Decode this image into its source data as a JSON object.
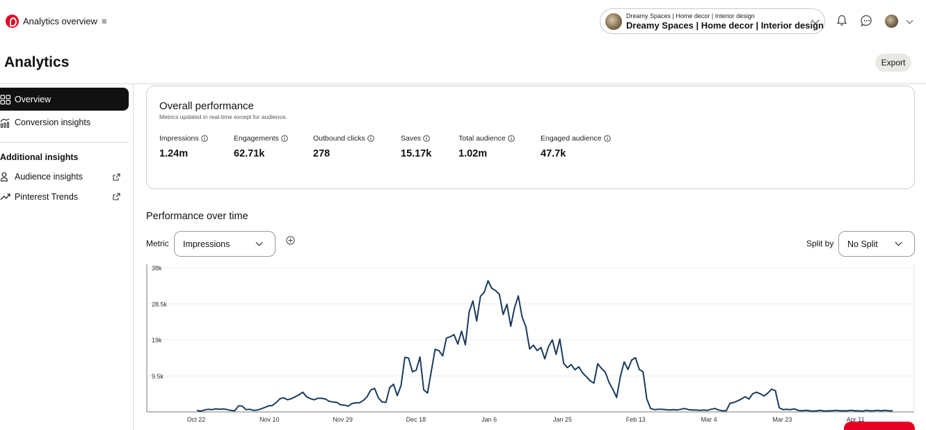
{
  "header": {
    "app_title": "Analytics overview",
    "account": {
      "small_line": "Dreamy Spaces | Home decor | Interior design",
      "name": "Dreamy Spaces | Home decor | Interior design"
    }
  },
  "page": {
    "title": "Analytics",
    "export_label": "Export"
  },
  "sidebar": {
    "items": [
      {
        "label": "Overview"
      },
      {
        "label": "Conversion insights"
      }
    ],
    "section_heading": "Additional insights",
    "extra_items": [
      {
        "label": "Audience insights"
      },
      {
        "label": "Pinterest Trends"
      }
    ]
  },
  "overall": {
    "title": "Overall performance",
    "subtitle": "Metrics updated in real-time except for audience.",
    "metrics": [
      {
        "label": "Impressions",
        "value": "1.24m"
      },
      {
        "label": "Engagements",
        "value": "62.71k"
      },
      {
        "label": "Outbound clicks",
        "value": "278"
      },
      {
        "label": "Saves",
        "value": "15.17k"
      },
      {
        "label": "Total audience",
        "value": "1.02m"
      },
      {
        "label": "Engaged audience",
        "value": "47.7k"
      }
    ]
  },
  "performance": {
    "title": "Performance over time",
    "metric_label": "Metric",
    "metric_value": "Impressions",
    "split_label": "Split by",
    "split_value": "No Split"
  },
  "chart_data": {
    "type": "line",
    "ylim": [
      0,
      38000
    ],
    "y_ticks": [
      "38k",
      "28.5k",
      "19k",
      "9.5k"
    ],
    "x_tick_labels": [
      "Oct 22",
      "Nov 10",
      "Nov 29",
      "Dec 18",
      "Jan 6",
      "Jan 25",
      "Feb 13",
      "Mar 4",
      "Mar 23",
      "Apr 11"
    ],
    "series": [
      {
        "color": "#1a3a5c",
        "values": [
          400,
          200,
          500,
          700,
          600,
          800,
          700,
          800,
          600,
          400,
          300,
          1600,
          1500,
          600,
          700,
          400,
          500,
          800,
          1200,
          1600,
          1700,
          2500,
          3500,
          3700,
          3200,
          3500,
          4000,
          4500,
          5200,
          4000,
          3500,
          3200,
          3600,
          3600,
          3400,
          2800,
          2600,
          2500,
          1900,
          1800,
          1500,
          2200,
          2400,
          2400,
          3000,
          4000,
          5800,
          6200,
          3700,
          2600,
          2500,
          6400,
          7300,
          4300,
          7000,
          14400,
          14200,
          10600,
          11000,
          14500,
          5800,
          5000,
          10800,
          16500,
          16200,
          14800,
          19500,
          19800,
          20400,
          17900,
          21300,
          17700,
          26300,
          29300,
          24000,
          30500,
          31600,
          34600,
          32600,
          32000,
          31000,
          25700,
          28400,
          22600,
          27400,
          30600,
          25100,
          22500,
          16600,
          17600,
          16200,
          17000,
          14000,
          17200,
          19000,
          15200,
          19200,
          12800,
          11700,
          12500,
          11100,
          11900,
          10300,
          9300,
          8200,
          7600,
          12700,
          11500,
          10500,
          7800,
          6000,
          3800,
          9300,
          13200,
          11200,
          13700,
          14300,
          11200,
          10600,
          3400,
          900,
          600,
          700,
          700,
          600,
          500,
          600,
          500,
          700,
          900,
          600,
          500,
          500,
          400,
          500,
          400,
          700,
          900,
          500,
          300,
          300,
          2300,
          2500,
          2900,
          3400,
          4000,
          3400,
          4800,
          5200,
          4800,
          4200,
          5000,
          6000,
          5600,
          1100,
          600,
          700,
          600,
          800,
          400,
          300,
          400,
          300,
          200,
          300,
          400,
          200,
          300,
          300,
          400,
          300,
          300,
          300,
          400,
          300,
          300,
          200,
          400,
          300,
          300,
          400,
          300,
          400,
          300,
          300
        ]
      }
    ]
  }
}
